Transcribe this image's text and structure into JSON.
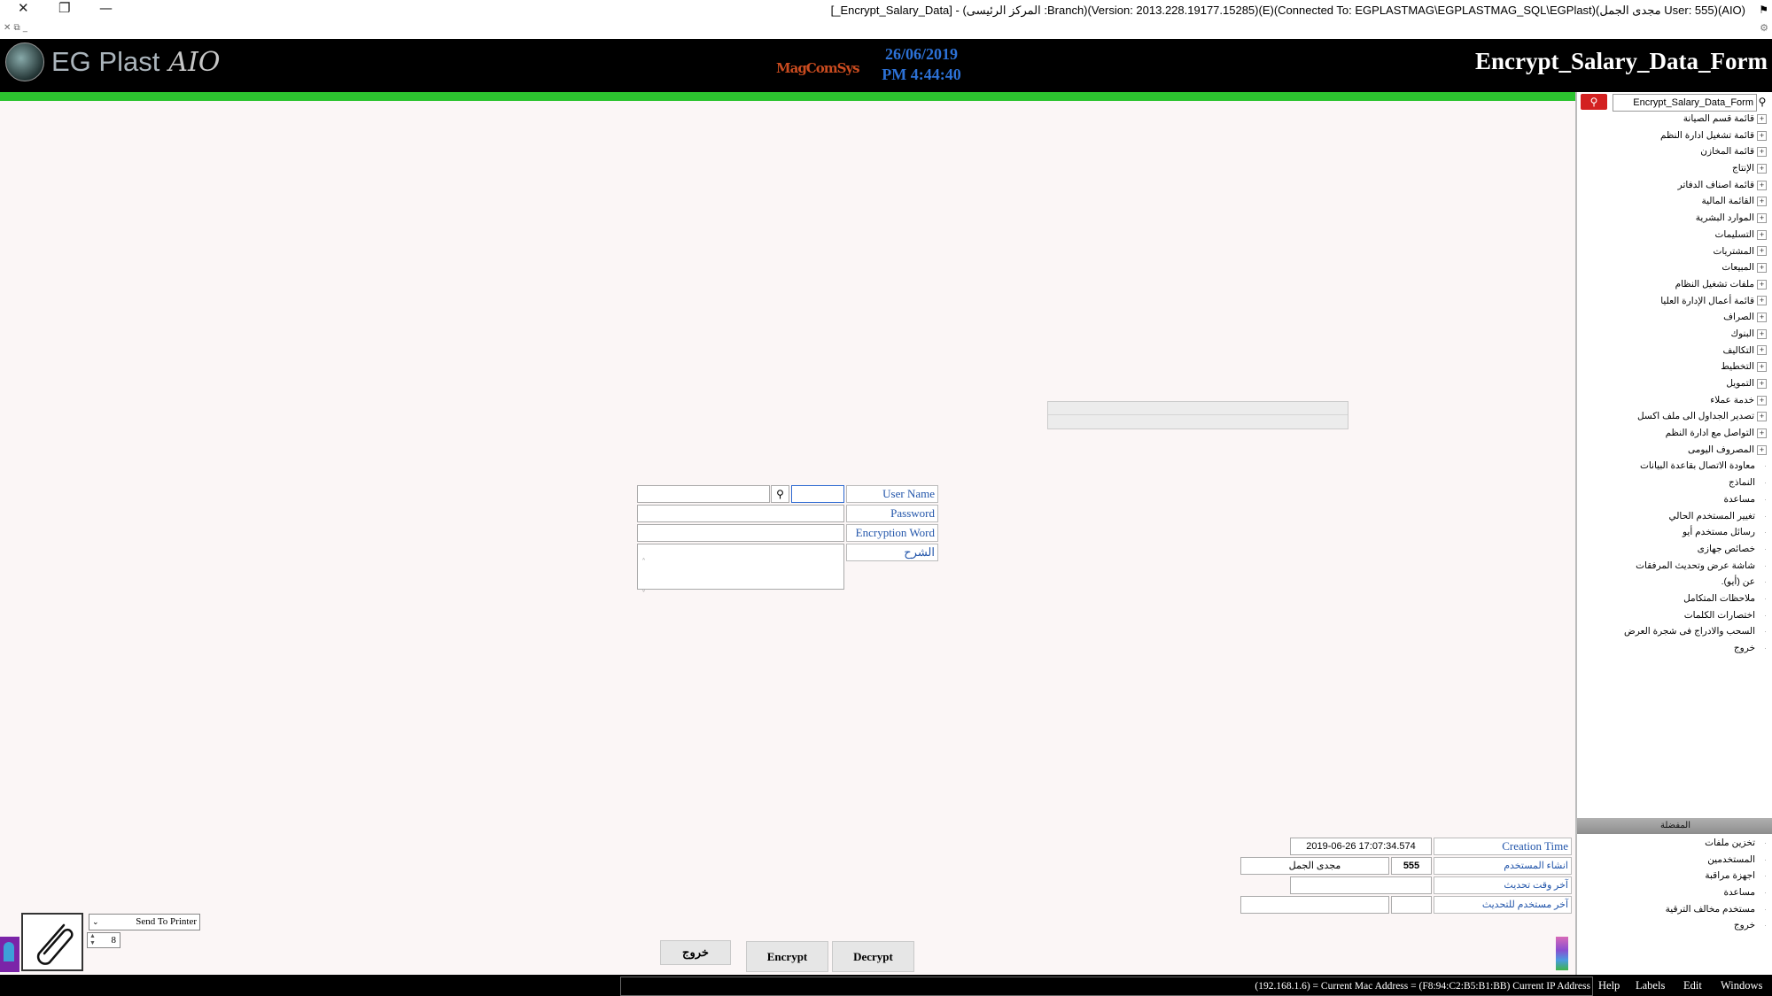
{
  "window": {
    "title": "[_Encrypt_Salary_Data] - (المركز الرئيسى :Branch)(Version: 2013.228.19177.15285)(E)(Connected To: EGPLASTMAG\\EGPLASTMAG_SQL\\EGPlast)(مجدى الجمل User: 555)(AIO)",
    "close_glyph": "✕",
    "restore_glyph": "❐",
    "minimize_glyph": "—",
    "mdi_controls": "✕ ⧉ _"
  },
  "header": {
    "logo_text": "EG Plast",
    "logo_suffix": "AIO",
    "brand": "MagComSys",
    "date": "26/06/2019",
    "time": "PM 4:44:40",
    "form_title": "Encrypt_Salary_Data_Form"
  },
  "sidebar": {
    "search_value": "Encrypt_Salary_Data_Form",
    "menu_items": [
      {
        "label": "قائمة قسم الصيانة",
        "expandable": true
      },
      {
        "label": "قائمة تشغيل ادارة النظم",
        "expandable": true
      },
      {
        "label": "قائمة المخازن",
        "expandable": true
      },
      {
        "label": "الإنتاج",
        "expandable": true
      },
      {
        "label": "قائمة اصناف الدفاتر",
        "expandable": true
      },
      {
        "label": "القائمة المالية",
        "expandable": true
      },
      {
        "label": "الموارد البشرية",
        "expandable": true
      },
      {
        "label": "التسليمات",
        "expandable": true
      },
      {
        "label": "المشتريات",
        "expandable": true
      },
      {
        "label": "المبيعات",
        "expandable": true
      },
      {
        "label": "ملفات تشغيل النظام",
        "expandable": true
      },
      {
        "label": "قائمة أعمال الإدارة العليا",
        "expandable": true
      },
      {
        "label": "الصراف",
        "expandable": true
      },
      {
        "label": "البنوك",
        "expandable": true
      },
      {
        "label": "التكاليف",
        "expandable": true
      },
      {
        "label": "التخطيط",
        "expandable": true
      },
      {
        "label": "التمويل",
        "expandable": true
      },
      {
        "label": "خدمة عملاء",
        "expandable": true
      },
      {
        "label": "تصدير الجداول الى ملف اكسل",
        "expandable": true
      },
      {
        "label": "التواصل مع ادارة النظم",
        "expandable": true
      },
      {
        "label": "المصروف اليومى",
        "expandable": true
      },
      {
        "label": "معاودة الاتصال بقاعدة البيانات",
        "expandable": false
      },
      {
        "label": "النماذج",
        "expandable": false
      },
      {
        "label": "مساعدة",
        "expandable": false
      },
      {
        "label": "تغيير المستخدم الحالي",
        "expandable": false
      },
      {
        "label": "رسائل مستخدم أيو",
        "expandable": false
      },
      {
        "label": "خصائص جهازى",
        "expandable": false
      },
      {
        "label": "شاشة عرض وتحديث المرفقات",
        "expandable": false
      },
      {
        "label": "عن (أيو).",
        "expandable": false
      },
      {
        "label": "ملاحظات المتكامل",
        "expandable": false
      },
      {
        "label": "اختصارات الكلمات",
        "expandable": false
      },
      {
        "label": "السحب والادراج فى شجرة العرض",
        "expandable": false
      },
      {
        "label": "خروج",
        "expandable": false
      }
    ],
    "section_title": "المفضلة",
    "favorites": [
      {
        "label": "تخزين ملفات"
      },
      {
        "label": "المستخدمين"
      },
      {
        "label": "اجهزة مراقبة"
      },
      {
        "label": "مساعدة"
      },
      {
        "label": "مستخدم مخالف الترقية"
      },
      {
        "label": "خروج"
      }
    ]
  },
  "form": {
    "user_name_label": "User Name",
    "user_name_value": "",
    "user_name_display": "",
    "password_label": "Password",
    "password_value": "",
    "encryption_word_label": "Encryption Word",
    "encryption_word_value": "",
    "description_label": "الشرح",
    "description_value": ""
  },
  "audit": {
    "creation_time_label": "Creation Time",
    "creation_time_value": "2019-06-26 17:07:34.574",
    "created_by_label": "انشاء المستخدم",
    "created_by_id": "555",
    "created_by_name": "مجدى الجمل",
    "last_update_time_label": "آخر وقت تحديث",
    "last_update_time_value": "",
    "last_update_user_label": "آخر مستخدم للتحديث",
    "last_update_user_id": "",
    "last_update_user_name": ""
  },
  "print": {
    "send_to_printer_label": "Send To Printer",
    "copies": "8"
  },
  "buttons": {
    "exit": "خروج",
    "encrypt": "Encrypt",
    "decrypt": "Decrypt"
  },
  "statusbar": {
    "info": "(192.168.1.6) = Current Mac Address = (F8:94:C2:B5:B1:BB) Current IP Address",
    "menus": [
      "Help",
      "Labels",
      "Edit",
      "Windows"
    ]
  },
  "colors": {
    "accent_green": "#2cc32f",
    "header_bg": "#000000",
    "label_blue": "#2255aa",
    "date_blue": "#2c71d6",
    "search_red": "#d32020"
  }
}
